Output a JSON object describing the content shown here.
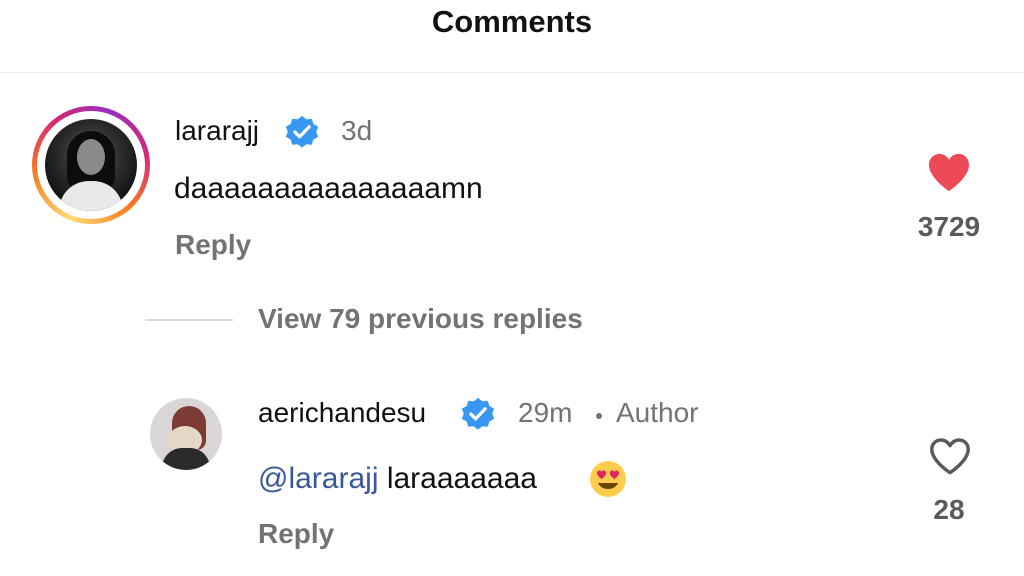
{
  "header": {
    "title": "Comments"
  },
  "comments": [
    {
      "username": "lararajj",
      "verified": true,
      "time": "3d",
      "text": "daaaaaaaaaaaaaaamn",
      "reply_label": "Reply",
      "liked": true,
      "like_count": "3729"
    }
  ],
  "view_replies_label": "View 79 previous replies",
  "replies": [
    {
      "username": "aerichandesu",
      "verified": true,
      "time": "29m",
      "author_label": "Author",
      "mention": "@lararajj",
      "text": "laraaaaaaa",
      "emoji": "heart-eyes",
      "reply_label": "Reply",
      "liked": false,
      "like_count": "28"
    }
  ],
  "colors": {
    "like_red": "#ed4956",
    "verified_blue": "#3897f0",
    "mention_blue": "#385898",
    "muted_gray": "#737373"
  }
}
